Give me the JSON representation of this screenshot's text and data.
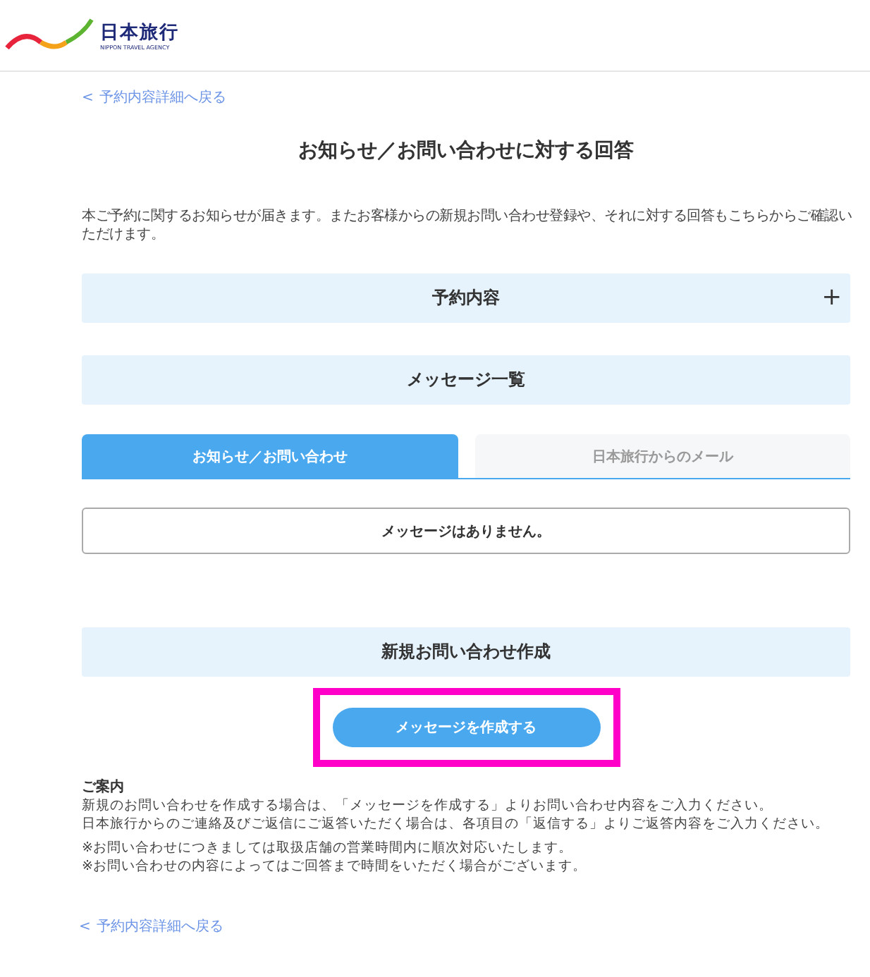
{
  "header": {
    "logo_name": "日本旅行",
    "logo_tagline": "NIPPON TRAVEL AGENCY"
  },
  "back_link_top": {
    "icon": "<",
    "label": "予約内容詳細へ戻る"
  },
  "title": "お知らせ／お問い合わせに対する回答",
  "description": "本ご予約に関するお知らせが届きます。またお客様からの新規お問い合わせ登録や、それに対する回答もこちらからご確認いただけます。",
  "reservation_section": {
    "label": "予約内容",
    "toggle": "+",
    "expanded": false
  },
  "messages_section": {
    "label": "メッセージ一覧"
  },
  "tabs": [
    {
      "label": "お知らせ／お問い合わせ",
      "selected": true
    },
    {
      "label": "日本旅行からのメール",
      "selected": false
    }
  ],
  "empty_message": "メッセージはありません。",
  "new_inquiry_section": {
    "label": "新規お問い合わせ作成"
  },
  "create_button": "メッセージを作成する",
  "guide": {
    "heading": "ご案内",
    "lines": [
      "新規のお問い合わせを作成する場合は、「メッセージを作成する」よりお問い合わせ内容をご入力ください。",
      "日本旅行からのご連絡及びご返信にご返答いただく場合は、各項目の「返信する」よりご返答内容をご入力ください。"
    ],
    "notes": [
      "※お問い合わせにつきましては取扱店舗の営業時間内に順次対応いたします。",
      "※お問い合わせの内容によってはご回答まで時間をいただく場合がございます。"
    ]
  },
  "back_link_bottom": {
    "icon": "<",
    "label": "予約内容詳細へ戻る"
  }
}
